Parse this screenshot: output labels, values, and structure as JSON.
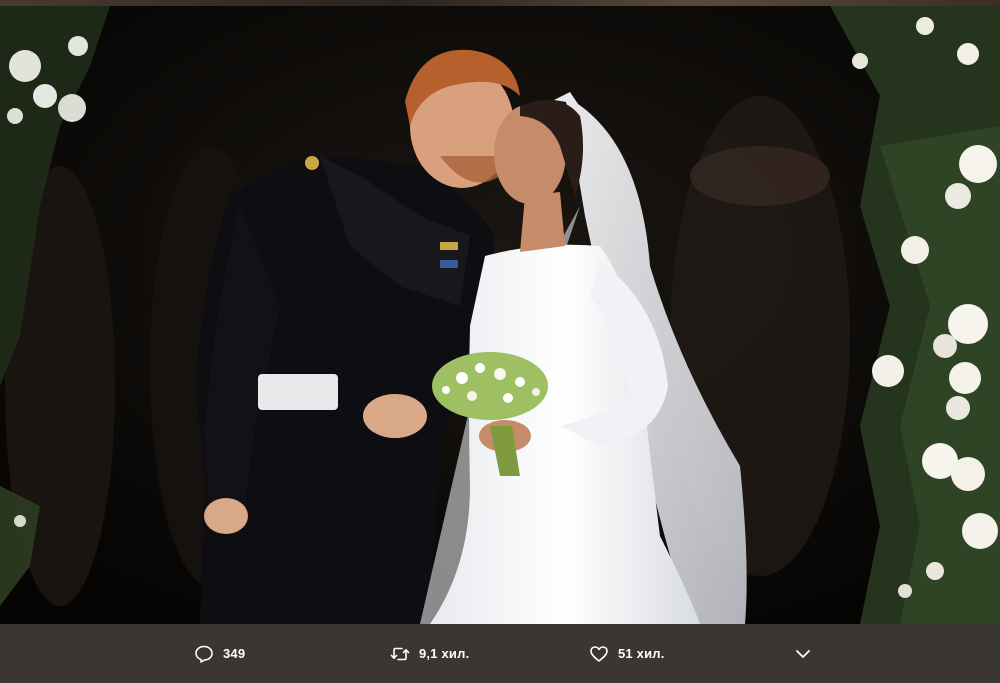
{
  "photo": {
    "description_icon": "photo"
  },
  "actions": {
    "reply": {
      "icon": "reply-icon",
      "count": "349"
    },
    "retweet": {
      "icon": "retweet-icon",
      "count": "9,1 хил."
    },
    "like": {
      "icon": "heart-icon",
      "count": "51 хил."
    },
    "more": {
      "icon": "chevron-down-icon"
    }
  },
  "colors": {
    "bar_background": "#3a3634",
    "icon_color": "#ffffff"
  }
}
